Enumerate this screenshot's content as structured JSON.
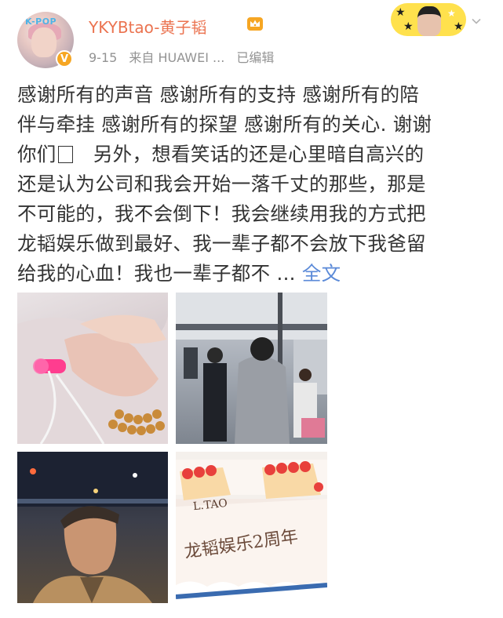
{
  "post": {
    "username": "YKYBtao-黄子韬",
    "date": "9-15",
    "source": "来自 HUAWEI ...",
    "edited": "已编辑",
    "text_lines": [
      "感谢所有的声音 感谢所有的支持 感谢所有的陪",
      "伴与牵挂 感谢所有的探望 感谢所有的关心. 谢谢",
      "你们",
      "另外，想看笑话的还是心里暗自高兴的",
      "还是认为公司和我会开始一落千丈的那些，那是",
      "不可能的，我不会倒下！我会继续用我的方式把",
      "龙韬娱乐做到最好、我一辈子都不会放下我爸留",
      "给我的心血！我也一辈子都不 ..."
    ],
    "full_text_link": "全文",
    "avatar_text": "K-POP",
    "verify_badge": "V"
  },
  "photos": {
    "cake_brand": "L.TAO",
    "cake_message": "龙韬娱乐2周年"
  },
  "colors": {
    "username": "#eb7350",
    "meta": "#939393",
    "link": "#5b8ad8",
    "badge": "#f6a623",
    "sticker": "#ffe14d"
  },
  "icons": {
    "crown": "crown-icon",
    "chevron": "chevron-down-icon",
    "verify": "verified-badge-icon"
  }
}
